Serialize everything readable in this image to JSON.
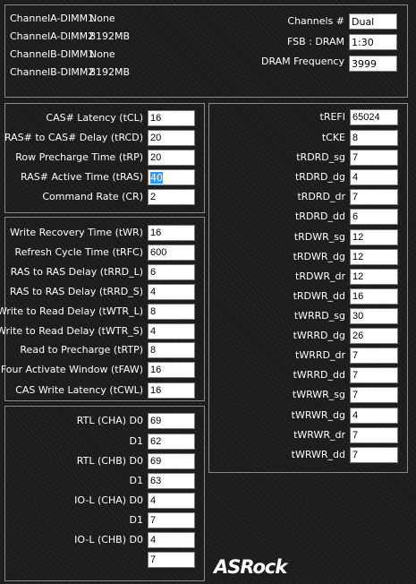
{
  "dimms": [
    {
      "name": "ChannelA-DIMM1",
      "value": "None"
    },
    {
      "name": "ChannelA-DIMM2",
      "value": "8192MB"
    },
    {
      "name": "ChannelB-DIMM1",
      "value": "None"
    },
    {
      "name": "ChannelB-DIMM2",
      "value": "8192MB"
    }
  ],
  "info": [
    {
      "label": "Channels #",
      "value": "Dual"
    },
    {
      "label": "FSB : DRAM",
      "value": "1:30"
    },
    {
      "label": "DRAM Frequency",
      "value": "3999"
    }
  ],
  "primary": [
    {
      "label": "CAS# Latency (tCL)",
      "value": "16"
    },
    {
      "label": "RAS# to CAS# Delay (tRCD)",
      "value": "20"
    },
    {
      "label": "Row Precharge Time (tRP)",
      "value": "20"
    },
    {
      "label": "RAS# Active Time (tRAS)",
      "value": "40"
    },
    {
      "label": "Command Rate (CR)",
      "value": "2"
    }
  ],
  "secondary": [
    {
      "label": "Write Recovery Time (tWR)",
      "value": "16"
    },
    {
      "label": "Refresh Cycle Time (tRFC)",
      "value": "600"
    },
    {
      "label": "RAS to RAS Delay (tRRD_L)",
      "value": "6"
    },
    {
      "label": "RAS to RAS Delay (tRRD_S)",
      "value": "4"
    },
    {
      "label": "Write to Read Delay (tWTR_L)",
      "value": "8"
    },
    {
      "label": "Write to Read Delay (tWTR_S)",
      "value": "4"
    },
    {
      "label": "Read to Precharge (tRTP)",
      "value": "8"
    },
    {
      "label": "Four Activate Window (tFAW)",
      "value": "16"
    },
    {
      "label": "CAS Write Latency (tCWL)",
      "value": "16"
    }
  ],
  "rtl": [
    {
      "label": "RTL (CHA) D0",
      "value": "69"
    },
    {
      "label": "D1",
      "value": "62"
    },
    {
      "label": "RTL (CHB) D0",
      "value": "69"
    },
    {
      "label": "D1",
      "value": "63"
    },
    {
      "label": "IO-L (CHA) D0",
      "value": "4"
    },
    {
      "label": "D1",
      "value": "7"
    },
    {
      "label": "IO-L (CHB) D0",
      "value": "4"
    },
    {
      "label": "",
      "value": "7"
    }
  ],
  "tertiary": [
    {
      "label": "tREFI",
      "value": "65024"
    },
    {
      "label": "tCKE",
      "value": "8"
    },
    {
      "label": "tRDRD_sg",
      "value": "7"
    },
    {
      "label": "tRDRD_dg",
      "value": "4"
    },
    {
      "label": "tRDRD_dr",
      "value": "7"
    },
    {
      "label": "tRDRD_dd",
      "value": "6"
    },
    {
      "label": "tRDWR_sg",
      "value": "12"
    },
    {
      "label": "tRDWR_dg",
      "value": "12"
    },
    {
      "label": "tRDWR_dr",
      "value": "12"
    },
    {
      "label": "tRDWR_dd",
      "value": "16"
    },
    {
      "label": "tWRRD_sg",
      "value": "30"
    },
    {
      "label": "tWRRD_dg",
      "value": "26"
    },
    {
      "label": "tWRRD_dr",
      "value": "7"
    },
    {
      "label": "tWRRD_dd",
      "value": "7"
    },
    {
      "label": "tWRWR_sg",
      "value": "7"
    },
    {
      "label": "tWRWR_dg",
      "value": "4"
    },
    {
      "label": "tWRWR_dr",
      "value": "7"
    },
    {
      "label": "tWRWR_dd",
      "value": "7"
    }
  ],
  "brand": {
    "logo_text": "ASRock"
  }
}
